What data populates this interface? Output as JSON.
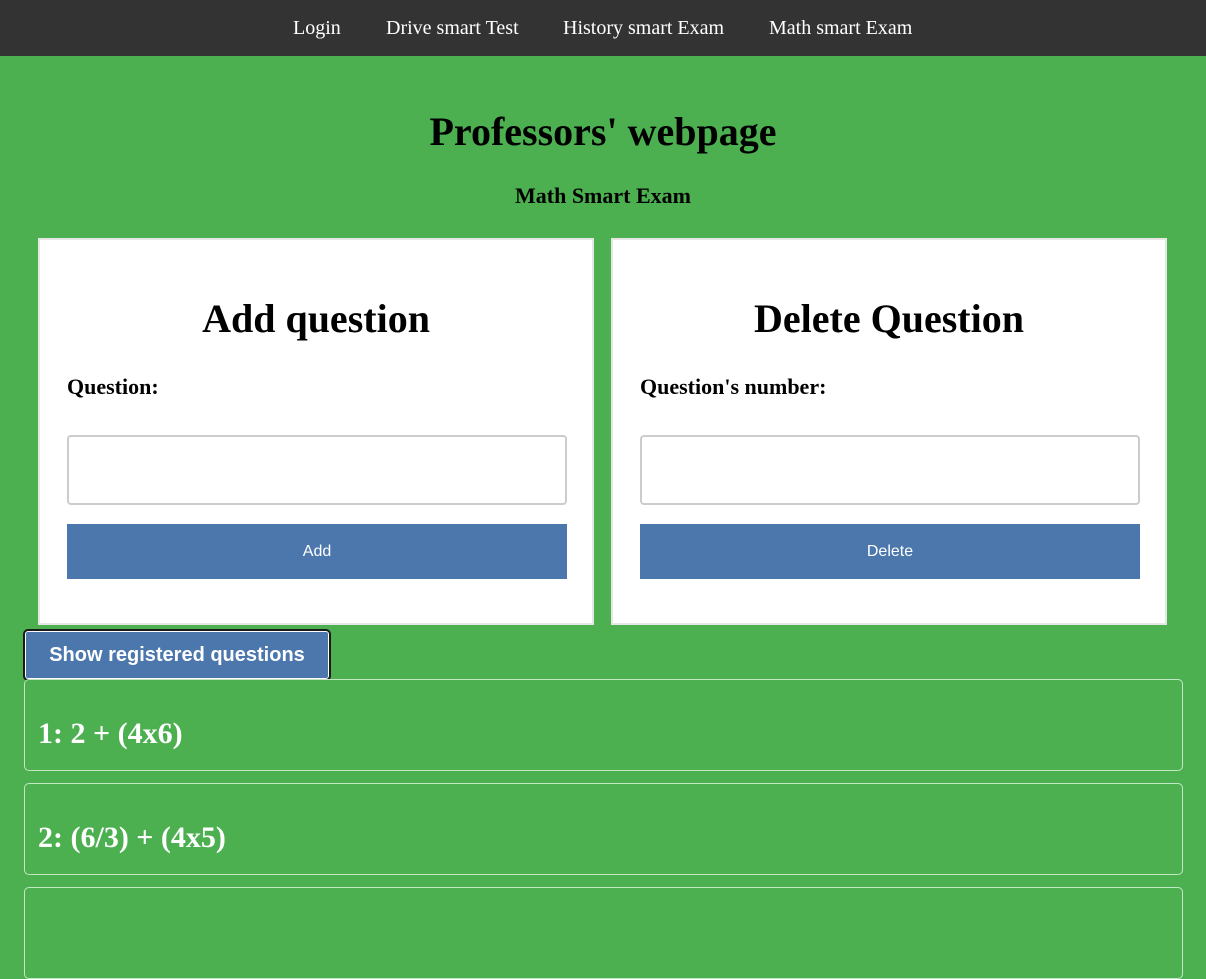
{
  "nav": {
    "items": [
      "Login",
      "Drive smart Test",
      "History smart Exam",
      "Math smart Exam"
    ]
  },
  "header": {
    "title": "Professors' webpage",
    "subtitle": "Math Smart Exam"
  },
  "add_card": {
    "title": "Add question",
    "label": "Question:",
    "input_value": "",
    "button_label": "Add"
  },
  "delete_card": {
    "title": "Delete Question",
    "label": "Question's number:",
    "input_value": "",
    "button_label": "Delete"
  },
  "show_button_label": "Show registered questions",
  "questions": [
    "1: 2 + (4x6)",
    "2: (6/3) + (4x5)",
    ""
  ],
  "colors": {
    "page_bg": "#4caf50",
    "navbar_bg": "#333333",
    "button_bg": "#4b77ad",
    "card_bg": "#ffffff"
  }
}
